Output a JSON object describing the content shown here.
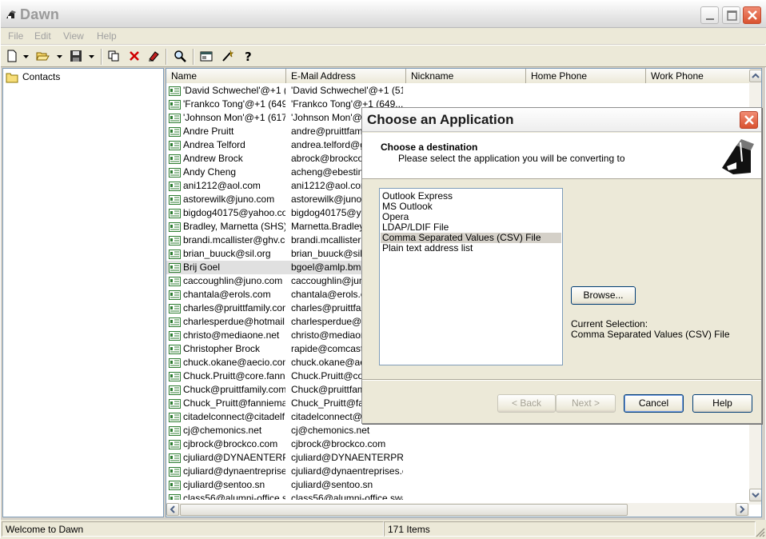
{
  "window": {
    "title": "Dawn"
  },
  "menu": [
    "File",
    "Edit",
    "View",
    "Help"
  ],
  "tree": {
    "root": "Contacts"
  },
  "list": {
    "columns": [
      "Name",
      "E-Mail Address",
      "Nickname",
      "Home Phone",
      "Work Phone"
    ],
    "rows": [
      {
        "name": "'David Schwechel'@+1 (...",
        "email": "'David Schwechel'@+1 (51..."
      },
      {
        "name": "'Frankco Tong'@+1 (649...",
        "email": "'Frankco Tong'@+1 (649..."
      },
      {
        "name": "'Johnson Mon'@+1 (617)...",
        "email": "'Johnson Mon'@+1 ..."
      },
      {
        "name": "Andre Pruitt",
        "email": "andre@pruittfamily..."
      },
      {
        "name": "Andrea Telford",
        "email": "andrea.telford@ge..."
      },
      {
        "name": "Andrew Brock",
        "email": "abrock@brockco..."
      },
      {
        "name": "Andy Cheng",
        "email": "acheng@ebestinc..."
      },
      {
        "name": "ani1212@aol.com",
        "email": "ani1212@aol.com"
      },
      {
        "name": "astorewilk@juno.com",
        "email": "astorewilk@juno.c..."
      },
      {
        "name": "bigdog40175@yahoo.com",
        "email": "bigdog40175@yah..."
      },
      {
        "name": "Bradley, Marnetta (SHS)",
        "email": "Marnetta.Bradley@..."
      },
      {
        "name": "brandi.mcallister@ghv.com",
        "email": "brandi.mcallister@..."
      },
      {
        "name": "brian_buuck@sil.org",
        "email": "brian_buuck@sil.o..."
      },
      {
        "name": "Brij Goel",
        "email": "bgoel@amlp.bm"
      },
      {
        "name": "caccoughlin@juno.com",
        "email": "caccoughlin@juno..."
      },
      {
        "name": "chantala@erols.com",
        "email": "chantala@erols.c..."
      },
      {
        "name": "charles@pruittfamily.com",
        "email": "charles@pruittfami..."
      },
      {
        "name": "charlesperdue@hotmail....",
        "email": "charlesperdue@ho..."
      },
      {
        "name": "christo@mediaone.net",
        "email": "christo@mediaone..."
      },
      {
        "name": "Christopher Brock",
        "email": "rapide@comcast.n..."
      },
      {
        "name": "chuck.okane@aecio.com",
        "email": "chuck.okane@aec..."
      },
      {
        "name": "Chuck.Pruitt@core.fanni...",
        "email": "Chuck.Pruitt@core..."
      },
      {
        "name": "Chuck@pruittfamily.com",
        "email": "Chuck@pruittfamil..."
      },
      {
        "name": "Chuck_Pruitt@fanniema...",
        "email": "Chuck_Pruitt@fan..."
      },
      {
        "name": "citadelconnect@citadelf...",
        "email": "citadelconnect@c..."
      },
      {
        "name": "cj@chemonics.net",
        "email": "cj@chemonics.net"
      },
      {
        "name": "cjbrock@brockco.com",
        "email": "cjbrock@brockco.com"
      },
      {
        "name": "cjuliard@DYNAENTERP...",
        "email": "cjuliard@DYNAENTERPRI..."
      },
      {
        "name": "cjuliard@dynaentreprises...",
        "email": "cjuliard@dynaentreprises.c..."
      },
      {
        "name": "cjuliard@sentoo.sn",
        "email": "cjuliard@sentoo.sn"
      },
      {
        "name": "class56@alumni-office.s...",
        "email": "class56@alumni-office.swa..."
      }
    ]
  },
  "status": {
    "left": "Welcome to Dawn",
    "count": "171 Items"
  },
  "dialog": {
    "title": "Choose an Application",
    "heading": "Choose a destination",
    "subheading": "Please select the application you will be converting to",
    "apps": [
      "Outlook Express",
      "MS Outlook",
      "Opera",
      "LDAP/LDIF File",
      "Comma Separated Values (CSV) File",
      "Plain text address list"
    ],
    "browse_label": "Browse...",
    "current_selection_label": "Current Selection:",
    "current_selection_value": "Comma Separated Values (CSV) File",
    "back_label": "< Back",
    "next_label": "Next >",
    "cancel_label": "Cancel",
    "help_label": "Help"
  }
}
